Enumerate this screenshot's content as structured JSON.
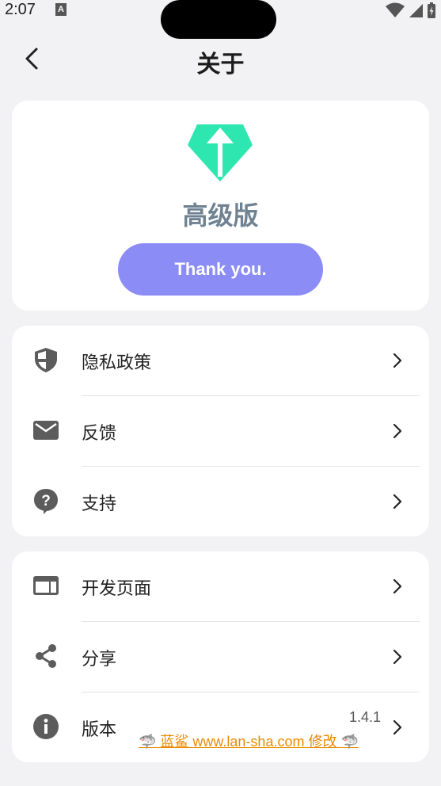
{
  "status_bar": {
    "time": "2:07",
    "notif_letter": "A"
  },
  "header": {
    "title": "关于"
  },
  "premium": {
    "title": "高级版",
    "button_label": "Thank you.",
    "accent_color": "#2ee6b0",
    "button_color": "#8c8cf6"
  },
  "menu_group_1": [
    {
      "label": "隐私政策",
      "icon": "shield-icon"
    },
    {
      "label": "反馈",
      "icon": "mail-icon"
    },
    {
      "label": "支持",
      "icon": "help-icon"
    }
  ],
  "menu_group_2": [
    {
      "label": "开发页面",
      "icon": "browser-window-icon"
    },
    {
      "label": "分享",
      "icon": "share-icon"
    },
    {
      "label": "版本",
      "icon": "info-icon",
      "value": "1.4.1"
    }
  ],
  "watermark": "🦈 蓝鲨 www.lan-sha.com 修改 🦈"
}
